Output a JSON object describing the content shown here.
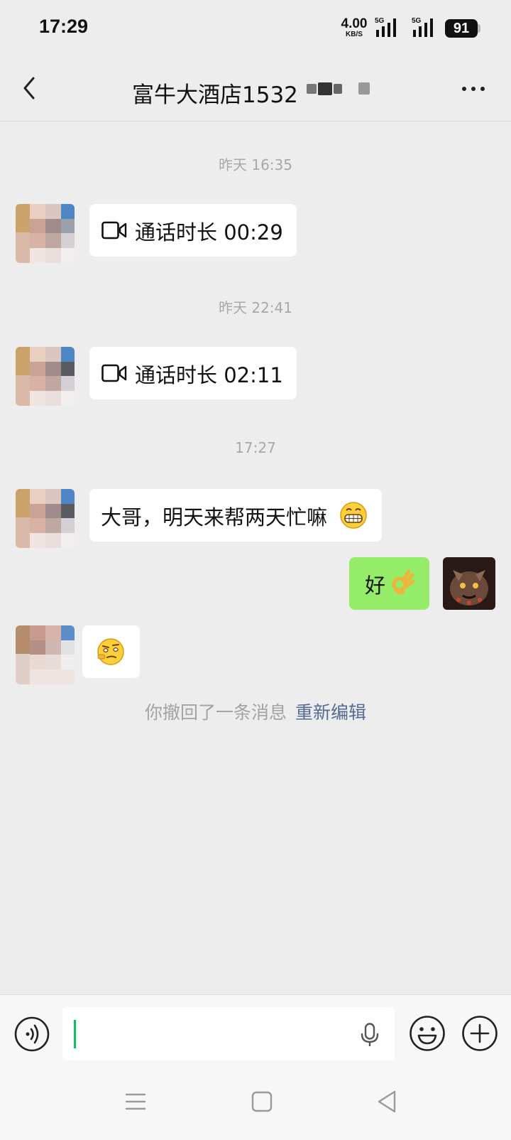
{
  "status_bar": {
    "time": "17:29",
    "net_speed_value": "4.00",
    "net_speed_unit": "KB/S",
    "sim1_label": "5G",
    "sim2_label": "5G",
    "battery": "91"
  },
  "header": {
    "title": "富牛大酒店1532",
    "back_icon": "chevron-left-icon",
    "more_icon": "more-dots-icon"
  },
  "messages": [
    {
      "type": "timestamp",
      "text": "昨天 16:35"
    },
    {
      "type": "call",
      "from": "contact",
      "icon": "video-call-icon",
      "text": "通话时长 00:29"
    },
    {
      "type": "timestamp",
      "text": "昨天 22:41"
    },
    {
      "type": "call",
      "from": "contact",
      "icon": "video-call-icon",
      "text": "通话时长 02:11"
    },
    {
      "type": "timestamp",
      "text": "17:27"
    },
    {
      "type": "text",
      "from": "contact",
      "text": "大哥，明天来帮两天忙嘛",
      "emoji": "grin-emoji-icon"
    },
    {
      "type": "text",
      "from": "me",
      "text": "好",
      "emoji": "ok-hand-emoji-icon"
    },
    {
      "type": "sticker",
      "from": "contact",
      "emoji": "thinking-emoji-icon"
    }
  ],
  "recall_notice": {
    "text": "你撤回了一条消息",
    "link": "重新编辑"
  },
  "input_bar": {
    "placeholder": "",
    "icons": [
      "voice-mode-icon",
      "microphone-icon",
      "emoji-icon",
      "plus-icon"
    ]
  },
  "nav_bar": {
    "icons": [
      "menu-icon",
      "home-icon",
      "back-triangle-icon"
    ]
  },
  "colors": {
    "background": "#ededed",
    "my_bubble": "#95ec69",
    "link": "#566b94",
    "caret": "#07c160"
  }
}
